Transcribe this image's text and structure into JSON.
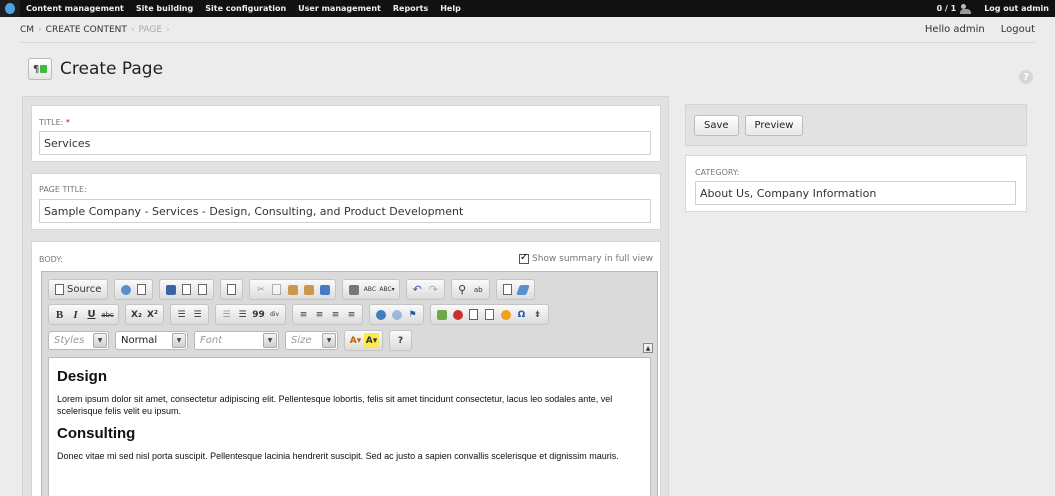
{
  "admin_menu": {
    "items": [
      "Content management",
      "Site building",
      "Site configuration",
      "User management",
      "Reports",
      "Help"
    ],
    "user_count": "0 / 1",
    "logout_label": "Log out admin"
  },
  "breadcrumb": {
    "items": [
      "CM",
      "CREATE CONTENT",
      "PAGE"
    ]
  },
  "user_links": {
    "greeting": "Hello admin",
    "logout": "Logout"
  },
  "page": {
    "icon_glyph": "¶",
    "title": "Create Page",
    "help_glyph": "?"
  },
  "fields": {
    "title": {
      "label": "TITLE:",
      "required_marker": "*",
      "value": "Services"
    },
    "page_title": {
      "label": "PAGE TITLE:",
      "value": "Sample Company - Services - Design, Consulting, and Product Development"
    },
    "body": {
      "label": "BODY:",
      "summary_toggle": "Show summary in full view"
    }
  },
  "editor": {
    "source_label": "Source",
    "format_combo": {
      "styles": "Styles",
      "format": "Normal",
      "font": "Font",
      "size": "Size"
    },
    "row2": {
      "bold": "B",
      "italic": "I",
      "underline": "U",
      "strike": "abc",
      "subscript": "X₂",
      "superscript": "X²",
      "blockquote": "99"
    },
    "content": [
      {
        "heading": "Design",
        "text": "Lorem ipsum dolor sit amet, consectetur adipiscing elit. Pellentesque lobortis, felis sit amet tincidunt consectetur, lacus leo sodales ante, vel scelerisque felis velit eu ipsum."
      },
      {
        "heading": "Consulting",
        "text": "Donec vitae mi sed nisl porta suscipit. Pellentesque lacinia hendrerit suscipit. Sed ac justo a sapien convallis scelerisque et dignissim mauris."
      }
    ]
  },
  "actions": {
    "save": "Save",
    "preview": "Preview"
  },
  "category": {
    "label": "CATEGORY:",
    "value": "About Us, Company Information"
  }
}
